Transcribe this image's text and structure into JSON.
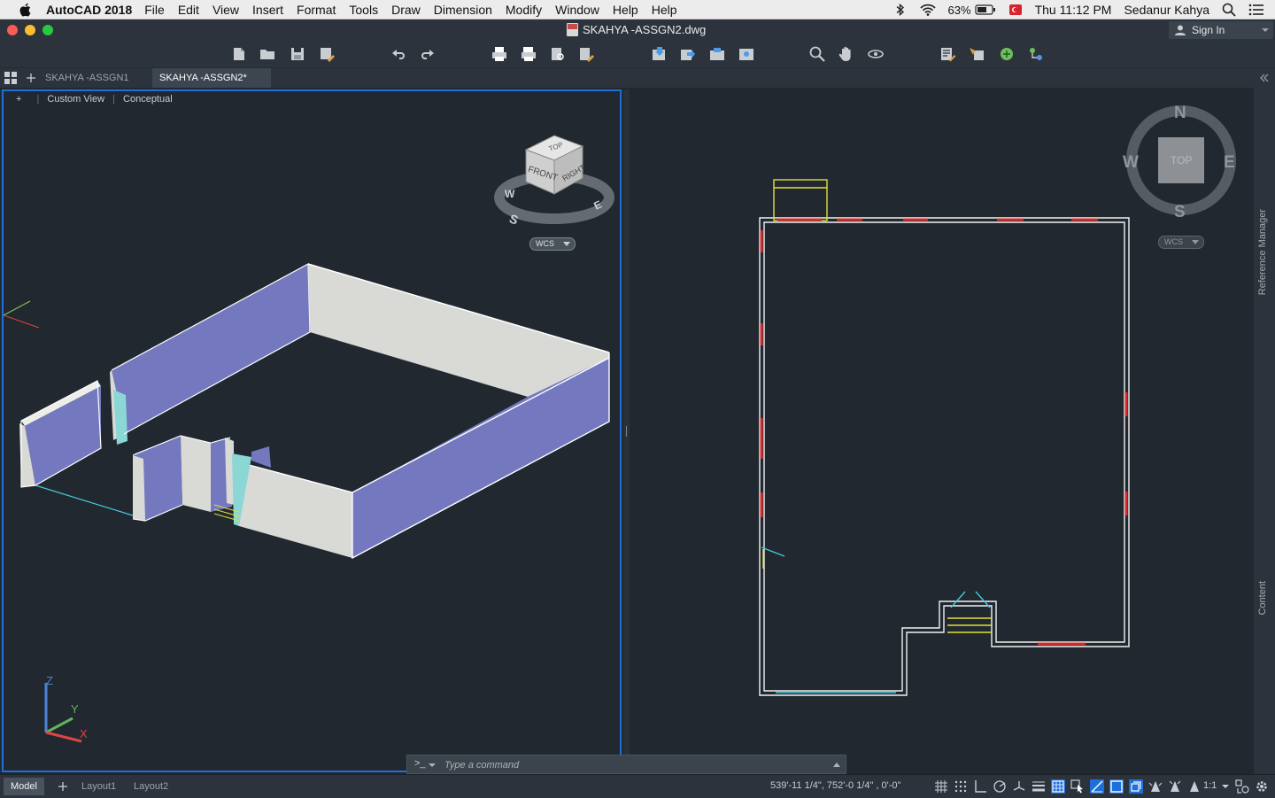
{
  "menubar": {
    "app_name": "AutoCAD 2018",
    "items": [
      "File",
      "Edit",
      "View",
      "Insert",
      "Format",
      "Tools",
      "Draw",
      "Dimension",
      "Modify",
      "Window",
      "Help",
      "Help"
    ],
    "battery": "63%",
    "clock": "Thu 11:12 PM",
    "user": "Sedanur Kahya"
  },
  "window": {
    "title": "SKAHYA -ASSGN2.dwg",
    "sign_in": "Sign In"
  },
  "tabs": [
    {
      "label": "SKAHYA -ASSGN1",
      "active": false
    },
    {
      "label": "SKAHYA -ASSGN2*",
      "active": true
    }
  ],
  "viewport_left": {
    "controls": [
      "+",
      "Custom View",
      "Conceptual"
    ],
    "viewcube": {
      "faces": [
        "TOP",
        "FRONT",
        "RIGHT"
      ],
      "compass": [
        "W",
        "S",
        "E"
      ],
      "ucs": "WCS"
    },
    "ucs_axes": [
      "X",
      "Y",
      "Z"
    ]
  },
  "viewport_right": {
    "viewcube": {
      "face": "TOP",
      "compass": [
        "N",
        "W",
        "E",
        "S"
      ],
      "ucs": "WCS"
    }
  },
  "side_panels": [
    "Reference Manager",
    "Content"
  ],
  "command": {
    "prompt": ">_",
    "placeholder": "Type a command"
  },
  "status": {
    "layouts": [
      {
        "label": "Model",
        "active": true
      },
      {
        "label": "Layout1",
        "active": false
      },
      {
        "label": "Layout2",
        "active": false
      }
    ],
    "coordinates": "539'-11 1/4\", 752'-0 1/4\" , 0'-0\"",
    "scale": "1:1"
  },
  "colors": {
    "accent": "#1e6fd9",
    "wall_purple": "#7479bf",
    "wall_white": "#d9dad5",
    "plan_red": "#d42b2b",
    "plan_yellow": "#e2df3a",
    "plan_cyan": "#46c8d6"
  }
}
